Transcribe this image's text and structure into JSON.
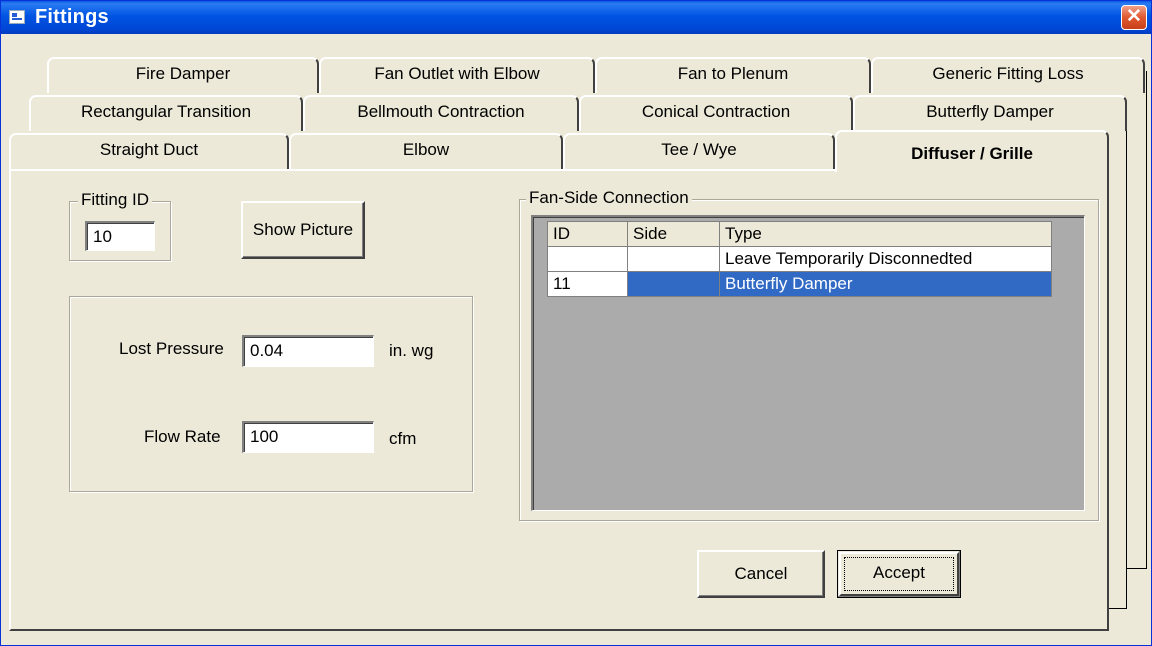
{
  "window": {
    "title": "Fittings",
    "close_glyph": "✕"
  },
  "tabs": {
    "row1": [
      "Fire Damper",
      "Fan Outlet with Elbow",
      "Fan to Plenum",
      "Generic Fitting Loss"
    ],
    "row2": [
      "Rectangular Transition",
      "Bellmouth Contraction",
      "Conical Contraction",
      "Butterfly Damper"
    ],
    "row3": [
      "Straight Duct",
      "Elbow",
      "Tee / Wye",
      "Diffuser / Grille"
    ],
    "active": "Diffuser / Grille"
  },
  "fitting_id": {
    "legend": "Fitting ID",
    "value": "10"
  },
  "show_picture_label": "Show Picture",
  "pressure": {
    "lost_pressure_label": "Lost Pressure",
    "lost_pressure_value": "0.04",
    "lost_pressure_unit": "in. wg",
    "flow_rate_label": "Flow Rate",
    "flow_rate_value": "100",
    "flow_rate_unit": "cfm"
  },
  "connection": {
    "legend": "Fan-Side Connection",
    "columns": [
      "ID",
      "Side",
      "Type"
    ],
    "rows": [
      {
        "id": "",
        "side": "",
        "type": "Leave Temporarily Disconnedted"
      },
      {
        "id": "11",
        "side": "",
        "type": "Butterfly Damper"
      }
    ]
  },
  "buttons": {
    "cancel": "Cancel",
    "accept": "Accept"
  },
  "colors": {
    "titlebar": "#0054e3",
    "selection": "#316ac5",
    "face": "#ece9d8"
  }
}
